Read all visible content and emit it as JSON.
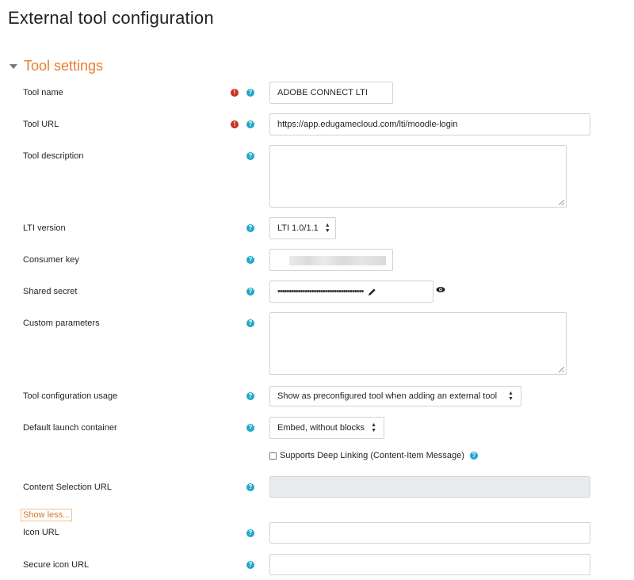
{
  "page": {
    "title": "External tool configuration"
  },
  "section": {
    "title": "Tool settings"
  },
  "fields": {
    "tool_name": {
      "label": "Tool name",
      "value": "ADOBE CONNECT LTI"
    },
    "tool_url": {
      "label": "Tool URL",
      "value": "https://app.edugamecloud.com/lti/moodle-login"
    },
    "tool_description": {
      "label": "Tool description",
      "value": ""
    },
    "lti_version": {
      "label": "LTI version",
      "value": "LTI 1.0/1.1"
    },
    "consumer_key": {
      "label": "Consumer key"
    },
    "shared_secret": {
      "label": "Shared secret",
      "value": "••••••••••••••••••••••••••••••••••••••"
    },
    "custom_parameters": {
      "label": "Custom parameters",
      "value": ""
    },
    "tool_configuration_usage": {
      "label": "Tool configuration usage",
      "value": "Show as preconfigured tool when adding an external tool"
    },
    "default_launch_container": {
      "label": "Default launch container",
      "value": "Embed, without blocks"
    },
    "supports_deep_linking": {
      "label": "Supports Deep Linking (Content-Item Message)",
      "checked": false
    },
    "content_selection_url": {
      "label": "Content Selection URL",
      "value": ""
    },
    "icon_url": {
      "label": "Icon URL",
      "value": ""
    },
    "secure_icon_url": {
      "label": "Secure icon URL",
      "value": ""
    }
  },
  "links": {
    "show_less": "Show less..."
  },
  "icons": {
    "required": "!",
    "help": "?",
    "edit": "pencil-icon",
    "reveal": "eye-icon"
  },
  "colors": {
    "accent": "#e87d2d",
    "help": "#1fa8c9",
    "required": "#ca3120"
  }
}
